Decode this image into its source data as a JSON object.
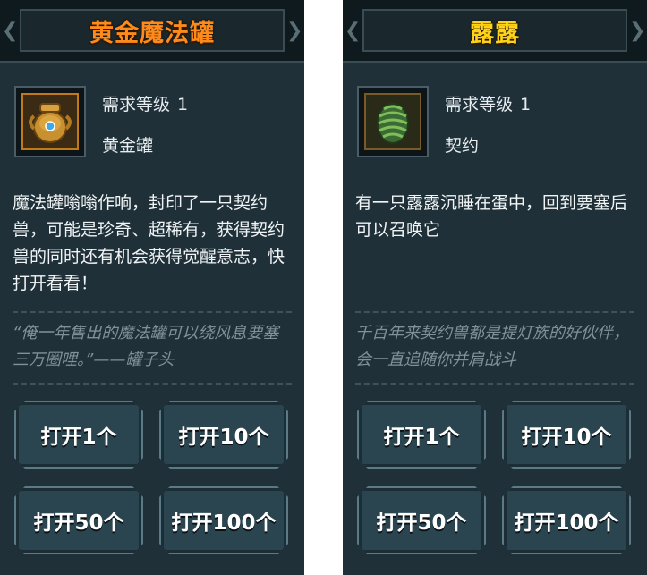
{
  "panels": [
    {
      "title": "黄金魔法罐",
      "title_color": "#ff8a1c",
      "icon": "golden-jar-icon",
      "requirement_label": "需求等级",
      "requirement_value": "1",
      "item_name": "黄金罐",
      "description": "魔法罐嗡嗡作响，封印了一只契约兽，可能是珍奇、超稀有，获得契约兽的同时还有机会获得觉醒意志，快打开看看！",
      "quote": "“俺一年售出的魔法罐可以绕风息要塞三万圈哩。”——罐子头",
      "buttons": [
        "打开1个",
        "打开10个",
        "打开50个",
        "打开100个"
      ]
    },
    {
      "title": "露露",
      "title_color": "#ffd21a",
      "icon": "green-egg-icon",
      "requirement_label": "需求等级",
      "requirement_value": "1",
      "item_name": "契约",
      "description": "有一只露露沉睡在蛋中，回到要塞后可以召唤它",
      "quote": "千百年来契约兽都是提灯族的好伙伴，会一直追随你并肩战斗",
      "buttons": [
        "打开1个",
        "打开10个",
        "打开50个",
        "打开100个"
      ]
    }
  ]
}
